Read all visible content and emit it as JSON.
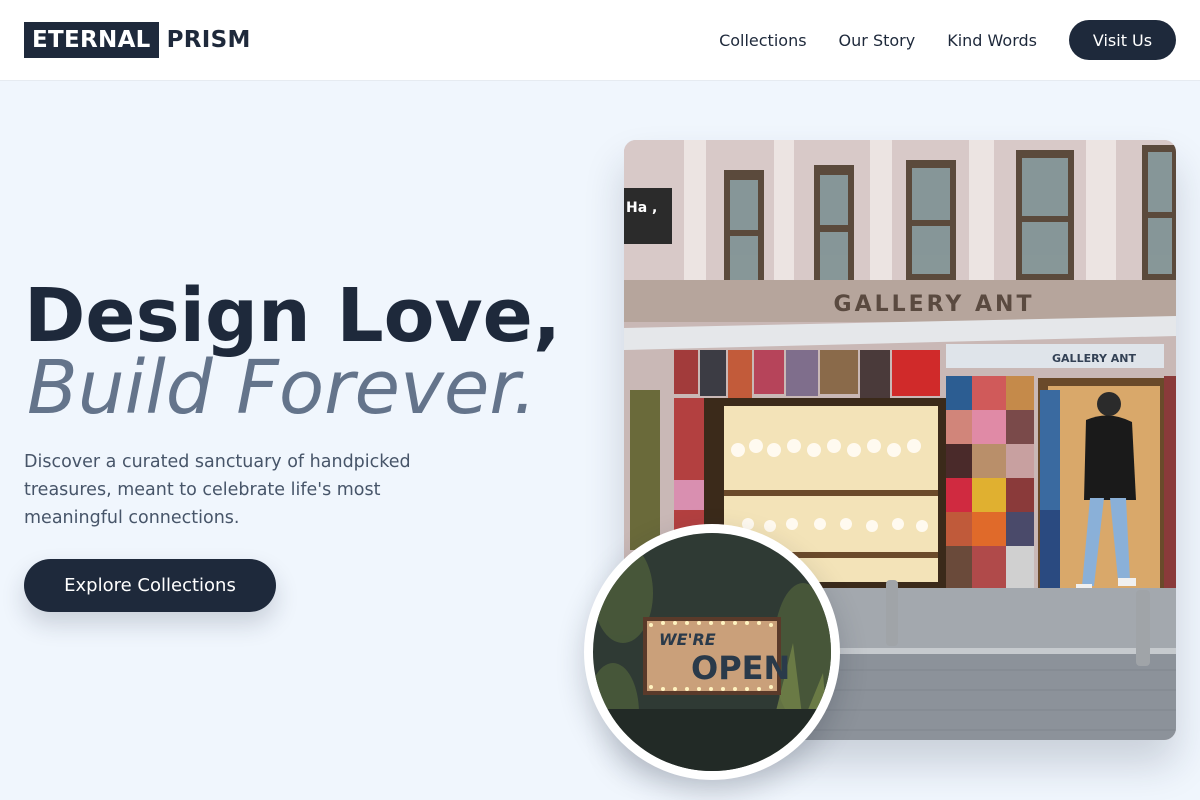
{
  "brand": {
    "box_text": "ETERNAL",
    "text": "PRISM"
  },
  "nav": {
    "links": [
      "Collections",
      "Our Story",
      "Kind Words"
    ],
    "cta": "Visit Us"
  },
  "hero": {
    "title": "Design Love,",
    "subtitle": "Build Forever.",
    "description": "Discover a curated sanctuary of handpicked treasures, meant to celebrate life's most meaningful connections.",
    "button": "Explore Collections"
  },
  "photo": {
    "sign_text": "GALLERY ANT",
    "sign_small_text": "GALLERY ANT",
    "side_sign_text": "Ha ,"
  },
  "circle": {
    "sign_line1": "WE'RE",
    "sign_line2": "OPEN"
  },
  "colors": {
    "primary": "#1e293b",
    "muted": "#64748b",
    "body_text": "#475569",
    "background": "#f0f6fd"
  }
}
